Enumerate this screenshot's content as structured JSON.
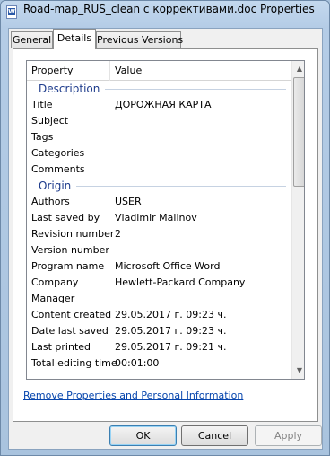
{
  "window": {
    "title": "Road-map_RUS_clean с коррективами.doc Properties",
    "icon": "word-doc-icon"
  },
  "tabs": [
    {
      "label": "General",
      "active": false
    },
    {
      "label": "Details",
      "active": true
    },
    {
      "label": "Previous Versions",
      "active": false
    }
  ],
  "details": {
    "columns": {
      "property": "Property",
      "value": "Value"
    },
    "groups": [
      {
        "name": "Description",
        "rows": [
          {
            "property": "Title",
            "value": "ДОРОЖНАЯ КАРТА"
          },
          {
            "property": "Subject",
            "value": ""
          },
          {
            "property": "Tags",
            "value": ""
          },
          {
            "property": "Categories",
            "value": ""
          },
          {
            "property": "Comments",
            "value": ""
          }
        ]
      },
      {
        "name": "Origin",
        "rows": [
          {
            "property": "Authors",
            "value": "USER"
          },
          {
            "property": "Last saved by",
            "value": "Vladimir Malinov"
          },
          {
            "property": "Revision number",
            "value": "2"
          },
          {
            "property": "Version number",
            "value": ""
          },
          {
            "property": "Program name",
            "value": "Microsoft Office Word"
          },
          {
            "property": "Company",
            "value": "Hewlett-Packard Company"
          },
          {
            "property": "Manager",
            "value": ""
          },
          {
            "property": "Content created",
            "value": "29.05.2017 г. 09:23 ч."
          },
          {
            "property": "Date last saved",
            "value": "29.05.2017 г. 09:23 ч."
          },
          {
            "property": "Last printed",
            "value": "29.05.2017 г. 09:21 ч."
          },
          {
            "property": "Total editing time",
            "value": "00:01:00"
          }
        ]
      }
    ]
  },
  "link": "Remove Properties and Personal Information",
  "buttons": {
    "ok": "OK",
    "cancel": "Cancel",
    "apply": "Apply"
  }
}
